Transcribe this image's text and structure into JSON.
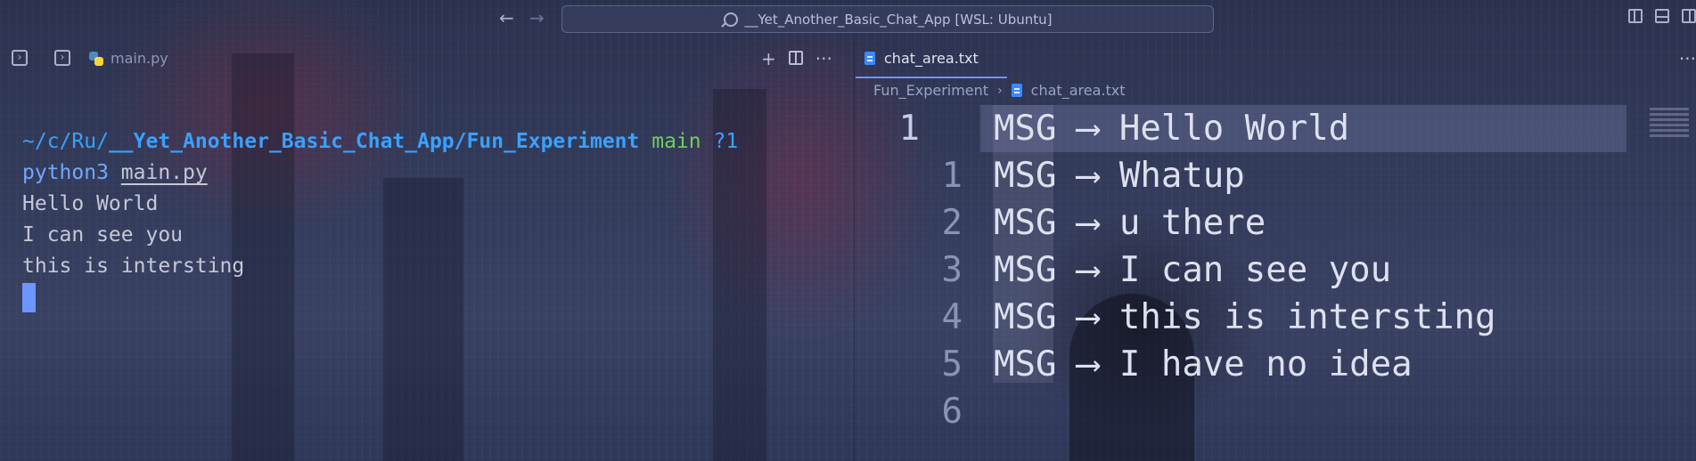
{
  "window": {
    "title": "__Yet_Another_Basic_Chat_App [WSL: Ubuntu]",
    "nav_back": "←",
    "nav_forward": "→"
  },
  "left_pane": {
    "tab_label": "main.py",
    "actions": {
      "new": "+",
      "more": "···"
    }
  },
  "terminal": {
    "prompt_tilde": "~/c/Ru/",
    "prompt_path": "__Yet_Another_Basic_Chat_App/Fun_Experiment",
    "branch": "main",
    "status": "?1",
    "command": "python3",
    "command_arg": "main.py",
    "output": [
      "Hello World",
      "I can see you",
      "this is intersting"
    ]
  },
  "right_pane": {
    "tab_label": "chat_area.txt",
    "more": "···",
    "breadcrumb": {
      "folder": "Fun_Experiment",
      "file": "chat_area.txt"
    },
    "lines": [
      {
        "num": "1",
        "text": "MSG ⟶ Hello World"
      },
      {
        "num": "1",
        "text": "MSG ⟶ Whatup"
      },
      {
        "num": "2",
        "text": "MSG ⟶ u there"
      },
      {
        "num": "3",
        "text": "MSG ⟶ I can see you"
      },
      {
        "num": "4",
        "text": "MSG ⟶ this is intersting"
      },
      {
        "num": "5",
        "text": "MSG ⟶ I have no idea"
      },
      {
        "num": "6",
        "text": ""
      }
    ]
  },
  "colors": {
    "accent": "#6e94ff",
    "path": "#3aa0ff",
    "branch": "#6fcf5a"
  }
}
